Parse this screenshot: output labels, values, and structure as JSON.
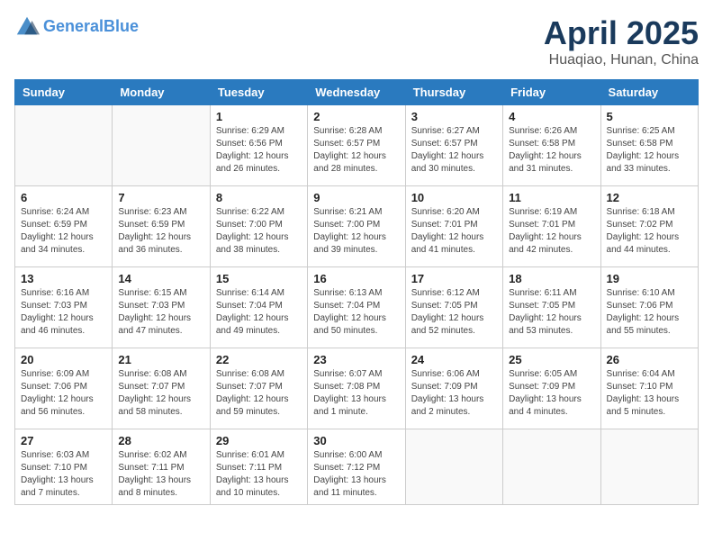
{
  "header": {
    "logo_line1": "General",
    "logo_line2": "Blue",
    "month_title": "April 2025",
    "location": "Huaqiao, Hunan, China"
  },
  "weekdays": [
    "Sunday",
    "Monday",
    "Tuesday",
    "Wednesday",
    "Thursday",
    "Friday",
    "Saturday"
  ],
  "weeks": [
    [
      {
        "day": "",
        "info": ""
      },
      {
        "day": "",
        "info": ""
      },
      {
        "day": "1",
        "info": "Sunrise: 6:29 AM\nSunset: 6:56 PM\nDaylight: 12 hours\nand 26 minutes."
      },
      {
        "day": "2",
        "info": "Sunrise: 6:28 AM\nSunset: 6:57 PM\nDaylight: 12 hours\nand 28 minutes."
      },
      {
        "day": "3",
        "info": "Sunrise: 6:27 AM\nSunset: 6:57 PM\nDaylight: 12 hours\nand 30 minutes."
      },
      {
        "day": "4",
        "info": "Sunrise: 6:26 AM\nSunset: 6:58 PM\nDaylight: 12 hours\nand 31 minutes."
      },
      {
        "day": "5",
        "info": "Sunrise: 6:25 AM\nSunset: 6:58 PM\nDaylight: 12 hours\nand 33 minutes."
      }
    ],
    [
      {
        "day": "6",
        "info": "Sunrise: 6:24 AM\nSunset: 6:59 PM\nDaylight: 12 hours\nand 34 minutes."
      },
      {
        "day": "7",
        "info": "Sunrise: 6:23 AM\nSunset: 6:59 PM\nDaylight: 12 hours\nand 36 minutes."
      },
      {
        "day": "8",
        "info": "Sunrise: 6:22 AM\nSunset: 7:00 PM\nDaylight: 12 hours\nand 38 minutes."
      },
      {
        "day": "9",
        "info": "Sunrise: 6:21 AM\nSunset: 7:00 PM\nDaylight: 12 hours\nand 39 minutes."
      },
      {
        "day": "10",
        "info": "Sunrise: 6:20 AM\nSunset: 7:01 PM\nDaylight: 12 hours\nand 41 minutes."
      },
      {
        "day": "11",
        "info": "Sunrise: 6:19 AM\nSunset: 7:01 PM\nDaylight: 12 hours\nand 42 minutes."
      },
      {
        "day": "12",
        "info": "Sunrise: 6:18 AM\nSunset: 7:02 PM\nDaylight: 12 hours\nand 44 minutes."
      }
    ],
    [
      {
        "day": "13",
        "info": "Sunrise: 6:16 AM\nSunset: 7:03 PM\nDaylight: 12 hours\nand 46 minutes."
      },
      {
        "day": "14",
        "info": "Sunrise: 6:15 AM\nSunset: 7:03 PM\nDaylight: 12 hours\nand 47 minutes."
      },
      {
        "day": "15",
        "info": "Sunrise: 6:14 AM\nSunset: 7:04 PM\nDaylight: 12 hours\nand 49 minutes."
      },
      {
        "day": "16",
        "info": "Sunrise: 6:13 AM\nSunset: 7:04 PM\nDaylight: 12 hours\nand 50 minutes."
      },
      {
        "day": "17",
        "info": "Sunrise: 6:12 AM\nSunset: 7:05 PM\nDaylight: 12 hours\nand 52 minutes."
      },
      {
        "day": "18",
        "info": "Sunrise: 6:11 AM\nSunset: 7:05 PM\nDaylight: 12 hours\nand 53 minutes."
      },
      {
        "day": "19",
        "info": "Sunrise: 6:10 AM\nSunset: 7:06 PM\nDaylight: 12 hours\nand 55 minutes."
      }
    ],
    [
      {
        "day": "20",
        "info": "Sunrise: 6:09 AM\nSunset: 7:06 PM\nDaylight: 12 hours\nand 56 minutes."
      },
      {
        "day": "21",
        "info": "Sunrise: 6:08 AM\nSunset: 7:07 PM\nDaylight: 12 hours\nand 58 minutes."
      },
      {
        "day": "22",
        "info": "Sunrise: 6:08 AM\nSunset: 7:07 PM\nDaylight: 12 hours\nand 59 minutes."
      },
      {
        "day": "23",
        "info": "Sunrise: 6:07 AM\nSunset: 7:08 PM\nDaylight: 13 hours\nand 1 minute."
      },
      {
        "day": "24",
        "info": "Sunrise: 6:06 AM\nSunset: 7:09 PM\nDaylight: 13 hours\nand 2 minutes."
      },
      {
        "day": "25",
        "info": "Sunrise: 6:05 AM\nSunset: 7:09 PM\nDaylight: 13 hours\nand 4 minutes."
      },
      {
        "day": "26",
        "info": "Sunrise: 6:04 AM\nSunset: 7:10 PM\nDaylight: 13 hours\nand 5 minutes."
      }
    ],
    [
      {
        "day": "27",
        "info": "Sunrise: 6:03 AM\nSunset: 7:10 PM\nDaylight: 13 hours\nand 7 minutes."
      },
      {
        "day": "28",
        "info": "Sunrise: 6:02 AM\nSunset: 7:11 PM\nDaylight: 13 hours\nand 8 minutes."
      },
      {
        "day": "29",
        "info": "Sunrise: 6:01 AM\nSunset: 7:11 PM\nDaylight: 13 hours\nand 10 minutes."
      },
      {
        "day": "30",
        "info": "Sunrise: 6:00 AM\nSunset: 7:12 PM\nDaylight: 13 hours\nand 11 minutes."
      },
      {
        "day": "",
        "info": ""
      },
      {
        "day": "",
        "info": ""
      },
      {
        "day": "",
        "info": ""
      }
    ]
  ]
}
